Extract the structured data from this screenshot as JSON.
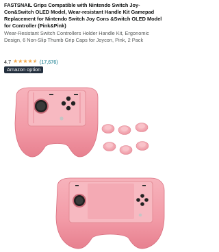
{
  "product": {
    "title": "FASTSNAIL Grips Compatible with Nintendo Switch Joy-Con&Switch OLED Model, Wear-resistant Handle Kit Gamepad Replacement for Nintendo Switch Joy Cons &Switch OLED Model for Controller (Pink&Pink)",
    "subtitle": "Wear-Resistant Switch Controllers Holder Handle Kit, Ergonomic Design, 6 Non-Slip Thumb Grip Caps for Joycon, Pink, 2 Pack",
    "rating": "4.7",
    "rating_stars": 4.7,
    "review_count": "(17,676)",
    "badge": "Amazon option"
  },
  "colors": {
    "grip_pink": "#f29aa6",
    "badge_bg": "#232f3e",
    "star": "#f3a847",
    "link": "#007185"
  },
  "image": {
    "description_icons": [
      "grip-icon",
      "thumb-cap-icon"
    ]
  }
}
